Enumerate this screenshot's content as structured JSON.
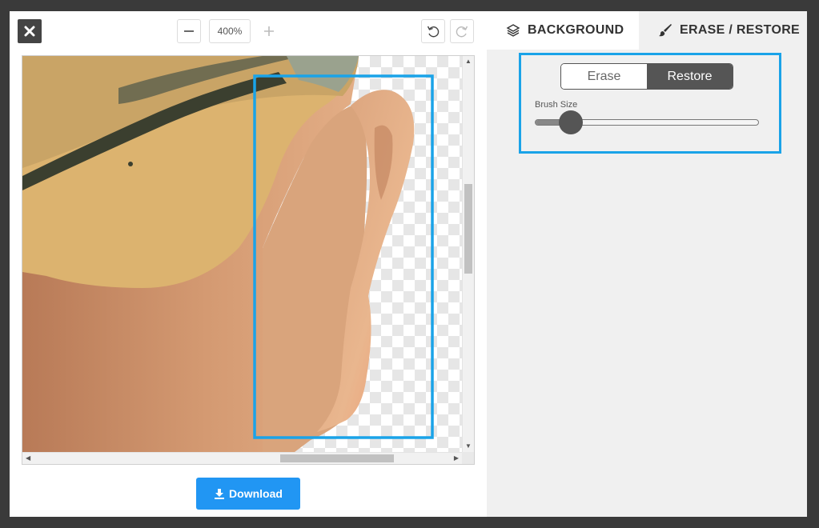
{
  "toolbar": {
    "zoom_level": "400%"
  },
  "actions": {
    "download_label": "Download"
  },
  "tabs": [
    {
      "label": "BACKGROUND",
      "icon": "layers-icon"
    },
    {
      "label": "ERASE / RESTORE",
      "icon": "paintbrush-icon"
    }
  ],
  "mode": {
    "options": [
      "Erase",
      "Restore"
    ],
    "selected": "Restore"
  },
  "brush": {
    "label": "Brush Size",
    "value_fraction": 0.16
  },
  "colors": {
    "accent": "#2196f3",
    "highlight": "#1aa3e8",
    "dark": "#555555"
  }
}
